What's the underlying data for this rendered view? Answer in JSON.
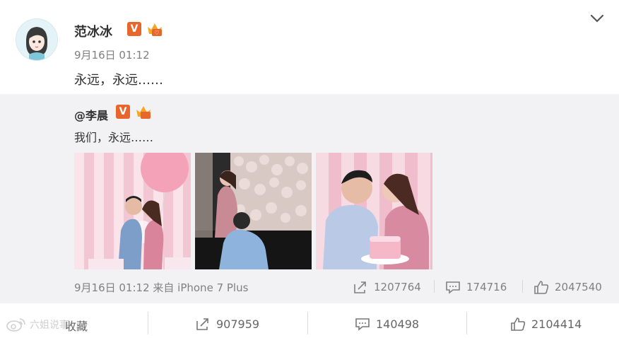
{
  "post": {
    "author": "范冰冰",
    "verified_badge": "V",
    "time": "9月16日 01:12",
    "text": "永远，永远……"
  },
  "repost": {
    "author": "@李晨",
    "verified_badge": "V",
    "text": "我们，永远……",
    "meta": "9月16日 01:12 来自 iPhone 7 Plus",
    "stats": {
      "reposts": "1207764",
      "comments": "174716",
      "likes": "2047540"
    }
  },
  "actions": {
    "favorite_label": "收藏",
    "reposts": "907959",
    "comments": "140498",
    "likes": "2104414"
  },
  "watermark": "六姐说事",
  "icons": [
    "chevron-down-icon",
    "repost-icon",
    "comment-icon",
    "like-icon",
    "crown-icon",
    "verified-icon"
  ],
  "colors": {
    "badge": "#e8662b",
    "panel_bg": "#f2f2f5",
    "muted": "#808080"
  }
}
